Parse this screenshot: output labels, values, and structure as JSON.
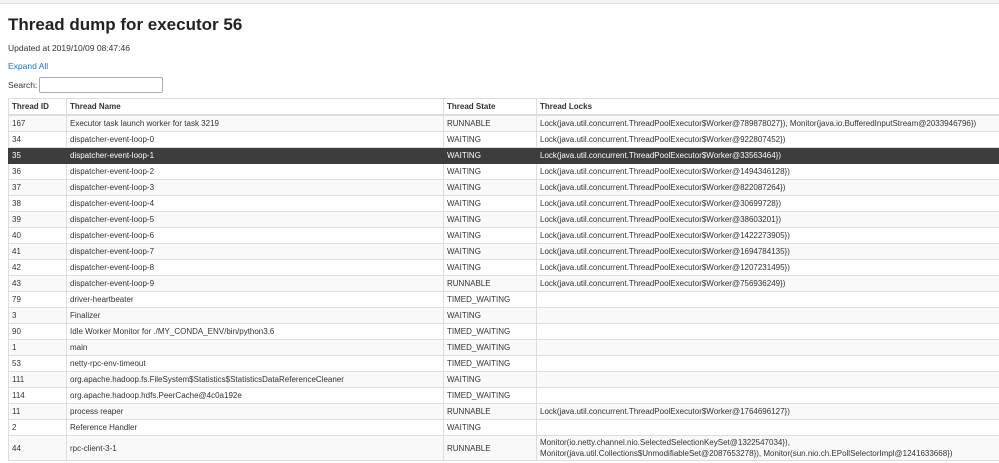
{
  "page": {
    "title": "Thread dump for executor 56",
    "updated": "Updated at 2019/10/09 08:47:46",
    "expand_all": "Expand All",
    "search_label": "Search:",
    "search_value": ""
  },
  "colors": {
    "link": "#1a73c9",
    "selected_row": "#3d3d3d"
  },
  "table": {
    "headers": [
      "Thread ID",
      "Thread Name",
      "Thread State",
      "Thread Locks"
    ],
    "selected_row_index": 2,
    "rows": [
      {
        "id": "167",
        "name": "Executor task launch worker for task 3219",
        "state": "RUNNABLE",
        "locks": "Lock(java.util.concurrent.ThreadPoolExecutor$Worker@789878027}), Monitor(java.io.BufferedInputStream@2033946796})"
      },
      {
        "id": "34",
        "name": "dispatcher-event-loop-0",
        "state": "WAITING",
        "locks": "Lock(java.util.concurrent.ThreadPoolExecutor$Worker@922807452})"
      },
      {
        "id": "35",
        "name": "dispatcher-event-loop-1",
        "state": "WAITING",
        "locks": "Lock(java.util.concurrent.ThreadPoolExecutor$Worker@33563464})"
      },
      {
        "id": "36",
        "name": "dispatcher-event-loop-2",
        "state": "WAITING",
        "locks": "Lock(java.util.concurrent.ThreadPoolExecutor$Worker@1494346128})"
      },
      {
        "id": "37",
        "name": "dispatcher-event-loop-3",
        "state": "WAITING",
        "locks": "Lock(java.util.concurrent.ThreadPoolExecutor$Worker@822087264})"
      },
      {
        "id": "38",
        "name": "dispatcher-event-loop-4",
        "state": "WAITING",
        "locks": "Lock(java.util.concurrent.ThreadPoolExecutor$Worker@30699728})"
      },
      {
        "id": "39",
        "name": "dispatcher-event-loop-5",
        "state": "WAITING",
        "locks": "Lock(java.util.concurrent.ThreadPoolExecutor$Worker@38603201})"
      },
      {
        "id": "40",
        "name": "dispatcher-event-loop-6",
        "state": "WAITING",
        "locks": "Lock(java.util.concurrent.ThreadPoolExecutor$Worker@1422273905})"
      },
      {
        "id": "41",
        "name": "dispatcher-event-loop-7",
        "state": "WAITING",
        "locks": "Lock(java.util.concurrent.ThreadPoolExecutor$Worker@1694784135})"
      },
      {
        "id": "42",
        "name": "dispatcher-event-loop-8",
        "state": "WAITING",
        "locks": "Lock(java.util.concurrent.ThreadPoolExecutor$Worker@1207231495})"
      },
      {
        "id": "43",
        "name": "dispatcher-event-loop-9",
        "state": "RUNNABLE",
        "locks": "Lock(java.util.concurrent.ThreadPoolExecutor$Worker@756936249})"
      },
      {
        "id": "79",
        "name": "driver-heartbeater",
        "state": "TIMED_WAITING",
        "locks": ""
      },
      {
        "id": "3",
        "name": "Finalizer",
        "state": "WAITING",
        "locks": ""
      },
      {
        "id": "90",
        "name": "Idle Worker Monitor for ./MY_CONDA_ENV/bin/python3.6",
        "state": "TIMED_WAITING",
        "locks": ""
      },
      {
        "id": "1",
        "name": "main",
        "state": "TIMED_WAITING",
        "locks": ""
      },
      {
        "id": "53",
        "name": "netty-rpc-env-timeout",
        "state": "TIMED_WAITING",
        "locks": ""
      },
      {
        "id": "111",
        "name": "org.apache.hadoop.fs.FileSystem$Statistics$StatisticsDataReferenceCleaner",
        "state": "WAITING",
        "locks": ""
      },
      {
        "id": "114",
        "name": "org.apache.hadoop.hdfs.PeerCache@4c0a192e",
        "state": "TIMED_WAITING",
        "locks": ""
      },
      {
        "id": "11",
        "name": "process reaper",
        "state": "RUNNABLE",
        "locks": "Lock(java.util.concurrent.ThreadPoolExecutor$Worker@1764696127})"
      },
      {
        "id": "2",
        "name": "Reference Handler",
        "state": "WAITING",
        "locks": ""
      },
      {
        "id": "44",
        "name": "rpc-client-3-1",
        "state": "RUNNABLE",
        "locks": "Monitor(io.netty.channel.nio.SelectedSelectionKeySet@1322547034}), Monitor(java.util.Collections$UnmodifiableSet@2087653278}), Monitor(sun.nio.ch.EPollSelectorImpl@1241633668})"
      }
    ]
  }
}
